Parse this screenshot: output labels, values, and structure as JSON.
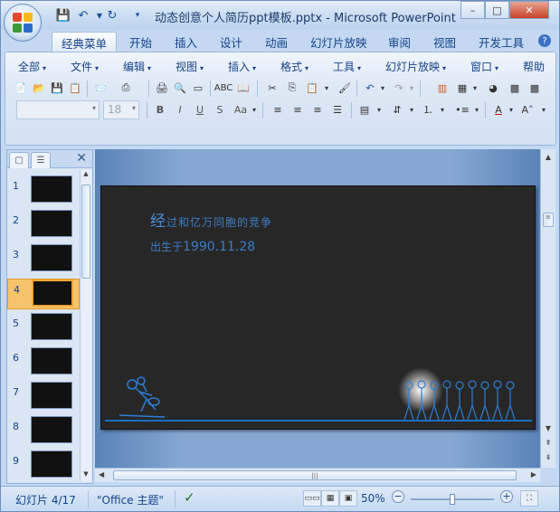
{
  "window": {
    "title": "动态创意个人简历ppt模板.pptx - Microsoft PowerPoint",
    "controls": {
      "minimize": "–",
      "maximize": "□",
      "close": "✕"
    }
  },
  "quick_access": [
    "save-icon",
    "undo-icon",
    "redo-icon",
    "customize-icon"
  ],
  "ribbon_tabs": [
    "经典菜单",
    "开始",
    "插入",
    "设计",
    "动画",
    "幻灯片放映",
    "审阅",
    "视图",
    "开发工具"
  ],
  "active_tab": "经典菜单",
  "help_icon": "?",
  "menus": [
    "全部",
    "文件",
    "编辑",
    "视图",
    "插入",
    "格式",
    "工具",
    "幻灯片放映",
    "窗口",
    "帮助"
  ],
  "font": {
    "name": "",
    "size": "18"
  },
  "toolbar_format": {
    "bold": "B",
    "italic": "I",
    "underline": "U",
    "strike": "S",
    "case": "Aa"
  },
  "sidebar": {
    "tab_slides_icon": "slides-tab-icon",
    "tab_outline_icon": "outline-tab-icon",
    "close": "✕",
    "thumbnails": [
      {
        "num": "1"
      },
      {
        "num": "2"
      },
      {
        "num": "3"
      },
      {
        "num": "4",
        "selected": true
      },
      {
        "num": "5"
      },
      {
        "num": "6"
      },
      {
        "num": "7"
      },
      {
        "num": "8"
      },
      {
        "num": "9"
      }
    ]
  },
  "slide": {
    "line1_first": "经",
    "line1_rest": "过和亿万同胞的竞争",
    "line2_prefix": "出生于",
    "line2_date": "1990.11.28"
  },
  "status": {
    "slide_info": "幻灯片 4/17",
    "theme": "\"Office 主题\"",
    "zoom": "50%",
    "zoom_level": 0.5
  },
  "colors": {
    "accent": "#15428b",
    "slide_bg": "#272727",
    "slide_text": "#3d7ec4",
    "selected_thumb": "#f6c46d"
  }
}
